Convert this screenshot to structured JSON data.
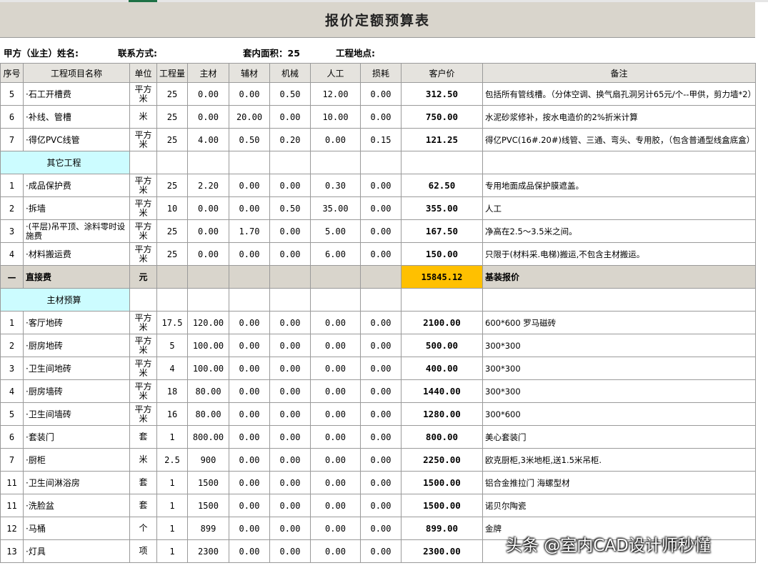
{
  "title": "报价定额预算表",
  "info": {
    "client_name_label": "甲方（业主）姓名:",
    "contact_label": "联系方式:",
    "area_label": "套内面积：25",
    "site_label": "工程地点:"
  },
  "headers": [
    "序号",
    "工程项目名称",
    "单位",
    "工程量",
    "主材",
    "辅材",
    "机械",
    "人工",
    "损耗",
    "客户价",
    "备注"
  ],
  "group1": [
    {
      "no": "5",
      "name": "·石工开槽费",
      "unit": "平方米",
      "qty": "25",
      "main": "0.00",
      "aux": "0.00",
      "mach": "0.50",
      "labor": "12.00",
      "loss": "0.00",
      "price": "312.50",
      "note": "包括所有管线槽。（分体空调、换气扇孔洞另计65元/个--甲供，剪力墙*2）"
    },
    {
      "no": "6",
      "name": "·补线、管槽",
      "unit": "米",
      "qty": "25",
      "main": "0.00",
      "aux": "20.00",
      "mach": "0.00",
      "labor": "10.00",
      "loss": "0.00",
      "price": "750.00",
      "note": "水泥砂浆修补，按水电造价的2%折米计算"
    },
    {
      "no": "7",
      "name": "·得亿PVC线管",
      "unit": "平方米",
      "qty": "25",
      "main": "4.00",
      "aux": "0.50",
      "mach": "0.20",
      "labor": "0.00",
      "loss": "0.15",
      "price": "121.25",
      "note": "得亿PVC(16#.20#)线管、三通、弯头、专用胶，（包含普通型线盒底盒）"
    }
  ],
  "section_other": "其它工程",
  "group2": [
    {
      "no": "1",
      "name": "·成品保护费",
      "unit": "平方米",
      "qty": "25",
      "main": "2.20",
      "aux": "0.00",
      "mach": "0.00",
      "labor": "0.30",
      "loss": "0.00",
      "price": "62.50",
      "note": "专用地面成品保护膜遮盖。"
    },
    {
      "no": "2",
      "name": "·拆墙",
      "unit": "平方米",
      "qty": "10",
      "main": "0.00",
      "aux": "0.00",
      "mach": "0.50",
      "labor": "35.00",
      "loss": "0.00",
      "price": "355.00",
      "note": "人工"
    },
    {
      "no": "3",
      "name": "·(平层)吊平顶、涂料零时设施费",
      "unit": "平方米",
      "qty": "25",
      "main": "0.00",
      "aux": "1.70",
      "mach": "0.00",
      "labor": "5.00",
      "loss": "0.00",
      "price": "167.50",
      "note": "净高在2.5～3.5米之间。"
    },
    {
      "no": "4",
      "name": "·材料搬运费",
      "unit": "平方米",
      "qty": "25",
      "main": "0.00",
      "aux": "0.00",
      "mach": "0.00",
      "labor": "6.00",
      "loss": "0.00",
      "price": "150.00",
      "note": "只限于(材料采.电梯)搬运,不包含主材搬运。"
    }
  ],
  "direct": {
    "no": "—",
    "name": "直接费",
    "unit": "元",
    "price": "15845.12",
    "note": "基装报价"
  },
  "section_main": "主材预算",
  "group3": [
    {
      "no": "1",
      "name": "·客厅地砖",
      "unit": "平方米",
      "qty": "17.5",
      "main": "120.00",
      "aux": "0.00",
      "mach": "0.00",
      "labor": "0.00",
      "loss": "0.00",
      "price": "2100.00",
      "note": "600*600 罗马磁砖"
    },
    {
      "no": "2",
      "name": "·厨房地砖",
      "unit": "平方米",
      "qty": "5",
      "main": "100.00",
      "aux": "0.00",
      "mach": "0.00",
      "labor": "0.00",
      "loss": "0.00",
      "price": "500.00",
      "note": "300*300"
    },
    {
      "no": "3",
      "name": "·卫生间地砖",
      "unit": "平方米",
      "qty": "4",
      "main": "100.00",
      "aux": "0.00",
      "mach": "0.00",
      "labor": "0.00",
      "loss": "0.00",
      "price": "400.00",
      "note": "300*300"
    },
    {
      "no": "4",
      "name": "·厨房墙砖",
      "unit": "平方米",
      "qty": "18",
      "main": "80.00",
      "aux": "0.00",
      "mach": "0.00",
      "labor": "0.00",
      "loss": "0.00",
      "price": "1440.00",
      "note": "300*300"
    },
    {
      "no": "5",
      "name": "·卫生间墙砖",
      "unit": "平方米",
      "qty": "16",
      "main": "80.00",
      "aux": "0.00",
      "mach": "0.00",
      "labor": "0.00",
      "loss": "0.00",
      "price": "1280.00",
      "note": "300*600"
    },
    {
      "no": "6",
      "name": "·套装门",
      "unit": "套",
      "qty": "1",
      "main": "800.00",
      "aux": "0.00",
      "mach": "0.00",
      "labor": "0.00",
      "loss": "0.00",
      "price": "800.00",
      "note": "美心套装门"
    },
    {
      "no": "7",
      "name": "·厨柜",
      "unit": "米",
      "qty": "2.5",
      "main": "900",
      "aux": "0.00",
      "mach": "0.00",
      "labor": "0.00",
      "loss": "0.00",
      "price": "2250.00",
      "note": "欧克厨柜,3米地柜,送1.5米吊柜."
    },
    {
      "no": "11",
      "name": "·卫生间淋浴房",
      "unit": "套",
      "qty": "1",
      "main": "1500",
      "aux": "0.00",
      "mach": "0.00",
      "labor": "0.00",
      "loss": "0.00",
      "price": "1500.00",
      "note": "铝合金推拉门 海螺型材"
    },
    {
      "no": "11",
      "name": "·洗脸盆",
      "unit": "套",
      "qty": "1",
      "main": "1500",
      "aux": "0.00",
      "mach": "0.00",
      "labor": "0.00",
      "loss": "0.00",
      "price": "1500.00",
      "note": "诺贝尔陶瓷"
    },
    {
      "no": "12",
      "name": "·马桶",
      "unit": "个",
      "qty": "1",
      "main": "899",
      "aux": "0.00",
      "mach": "0.00",
      "labor": "0.00",
      "loss": "0.00",
      "price": "899.00",
      "note": "金牌"
    },
    {
      "no": "13",
      "name": "·灯具",
      "unit": "项",
      "qty": "1",
      "main": "2300",
      "aux": "0.00",
      "mach": "0.00",
      "labor": "0.00",
      "loss": "0.00",
      "price": "2300.00",
      "note": ""
    }
  ],
  "watermark": "头条 @室内CAD设计师秒懂"
}
